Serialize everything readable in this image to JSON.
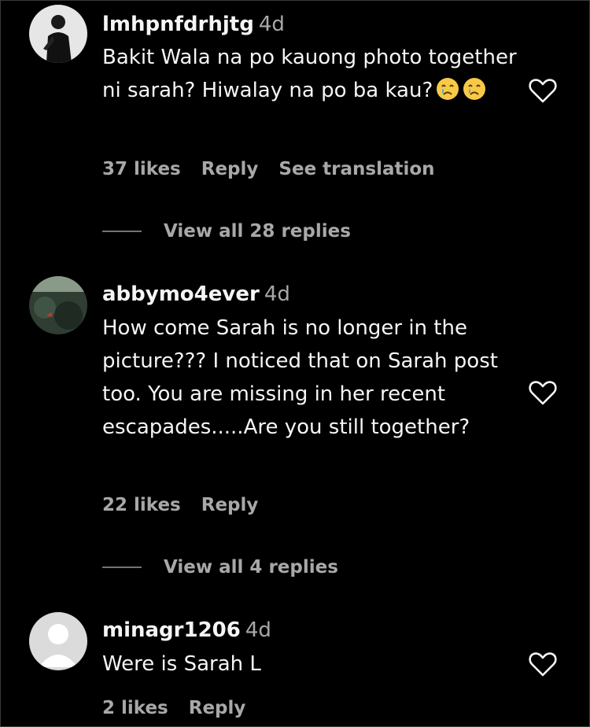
{
  "comments": [
    {
      "username": "lmhpnfdrhjtg",
      "time": "4d",
      "text": "Bakit Wala na po kauong photo together ni sarah? Hiwalay na po ba kau?",
      "emojis": [
        "crying-face",
        "crying-face"
      ],
      "likes": "37 likes",
      "reply": "Reply",
      "translate": "See translation",
      "view_replies": "View all 28 replies"
    },
    {
      "username": "abbymo4ever",
      "time": "4d",
      "text": "How come Sarah is no longer in the picture??? I noticed that on Sarah post too. You are missing in her recent escapades.....Are you still together?",
      "likes": "22 likes",
      "reply": "Reply",
      "view_replies": "View all 4 replies"
    },
    {
      "username": "minagr1206",
      "time": "4d",
      "text": "Were is Sarah L",
      "likes": "2 likes",
      "reply": "Reply"
    }
  ],
  "icons": {
    "like": "heart-outline-icon",
    "emoji": "crying-face-emoji"
  },
  "colors": {
    "background": "#000000",
    "primary_text": "#f5f5f5",
    "secondary_text": "#a8a8a8"
  }
}
